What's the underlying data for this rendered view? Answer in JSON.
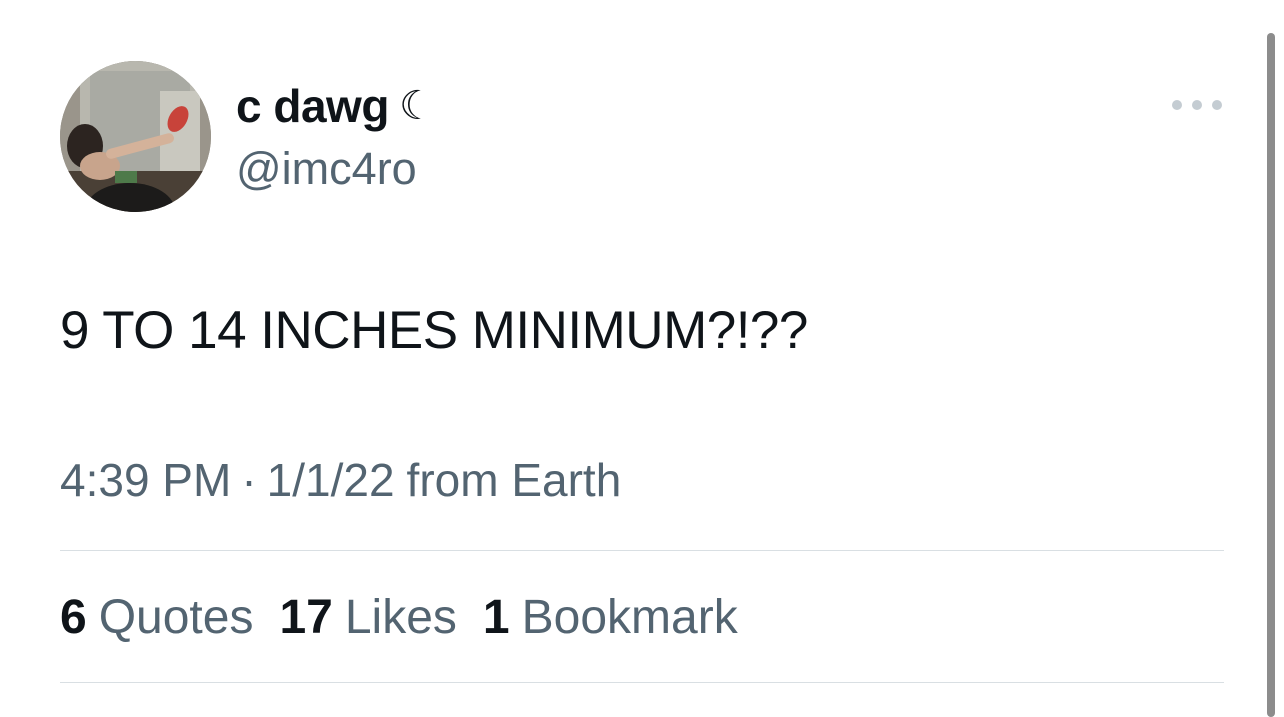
{
  "author": {
    "display_name": "c dawg",
    "name_emoji": "☾",
    "handle": "@imc4ro"
  },
  "tweet": {
    "text": "9 TO 14 INCHES MINIMUM?!??",
    "time": "4:39 PM",
    "separator": "·",
    "date": "1/1/22",
    "source": "from Earth"
  },
  "stats": {
    "quotes_count": "6",
    "quotes_label": "Quotes",
    "likes_count": "17",
    "likes_label": "Likes",
    "bookmarks_count": "1",
    "bookmarks_label": "Bookmark"
  },
  "icons": {
    "more": "more-options-icon"
  },
  "colors": {
    "primary_text": "#0f1419",
    "secondary_text": "#536471",
    "divider": "#d9dfe3"
  }
}
